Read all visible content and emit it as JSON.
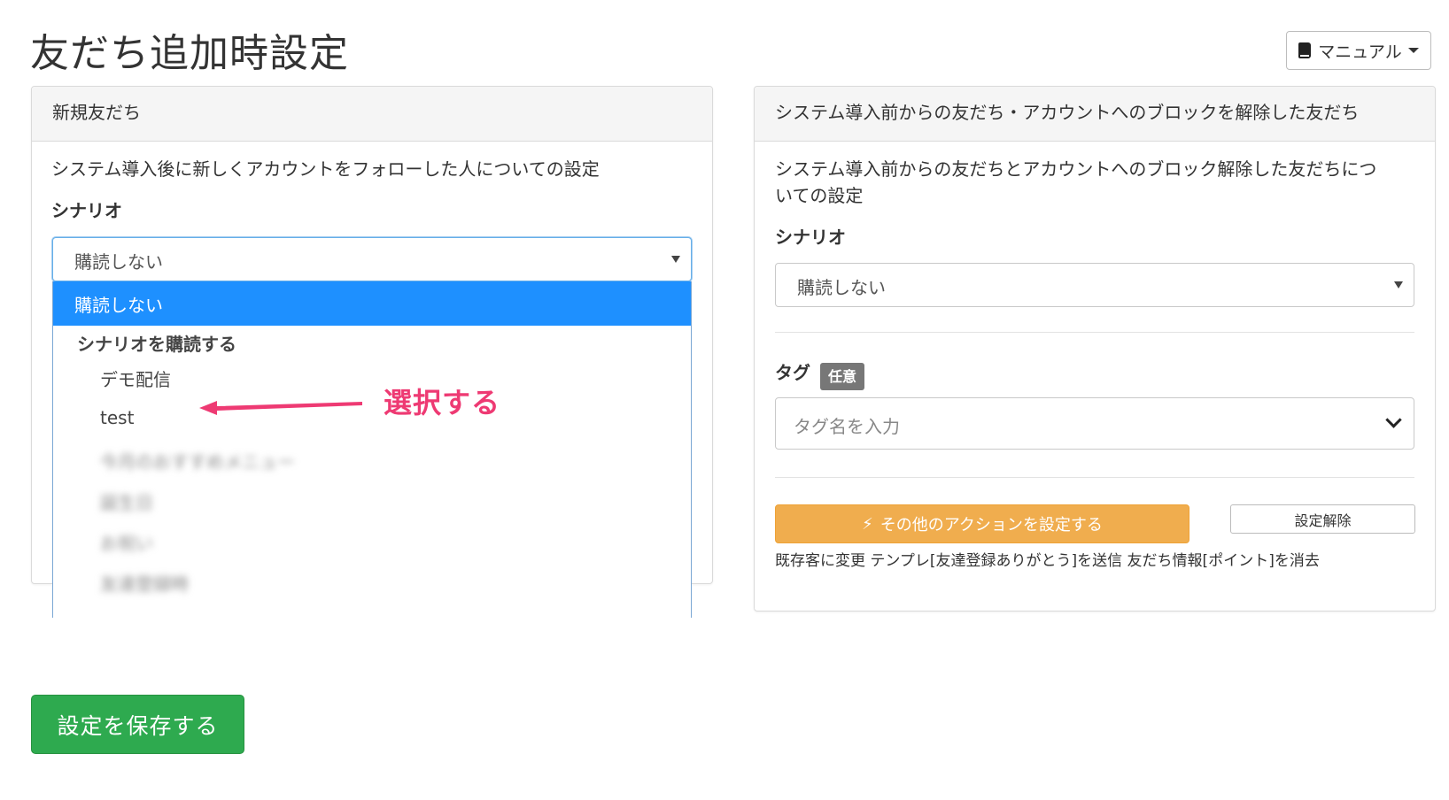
{
  "page": {
    "title": "友だち追加時設定"
  },
  "manual_button": {
    "label": "マニュアル",
    "icon": "book-icon"
  },
  "left_panel": {
    "heading": "新規友だち",
    "description": "システム導入後に新しくアカウントをフォローした人についての設定",
    "scenario_label": "シナリオ",
    "select_value": "購読しない",
    "dropdown": {
      "selected": "購読しない",
      "group_label": "シナリオを購読する",
      "items": [
        "デモ配信",
        "test",
        "今月のおすすめメニュー",
        "誕生日",
        "お祝い",
        "友達登録時"
      ]
    }
  },
  "annotation": {
    "text": "選択する",
    "color": "#ee3a73"
  },
  "right_panel": {
    "heading": "システム導入前からの友だち・アカウントへのブロックを解除した友だち",
    "description_line1": "システム導入前からの友だちとアカウントへのブロック解除した友だちにつ",
    "description_line2": "いての設定",
    "scenario_label": "シナリオ",
    "select_value": "購読しない",
    "tag_label": "タグ",
    "optional_badge": "任意",
    "tag_placeholder": "タグ名を入力",
    "action_button": "その他のアクションを設定する",
    "release_button": "設定解除",
    "action_summary": "既存客に変更 テンプレ[友達登録ありがとう]を送信 友だち情報[ポイント]を消去"
  },
  "save_button": {
    "label": "設定を保存する"
  },
  "colors": {
    "primary_blue": "#1e90ff",
    "success_green": "#2eaa4f",
    "warning_orange": "#f0ad4e",
    "badge_gray": "#777777"
  }
}
